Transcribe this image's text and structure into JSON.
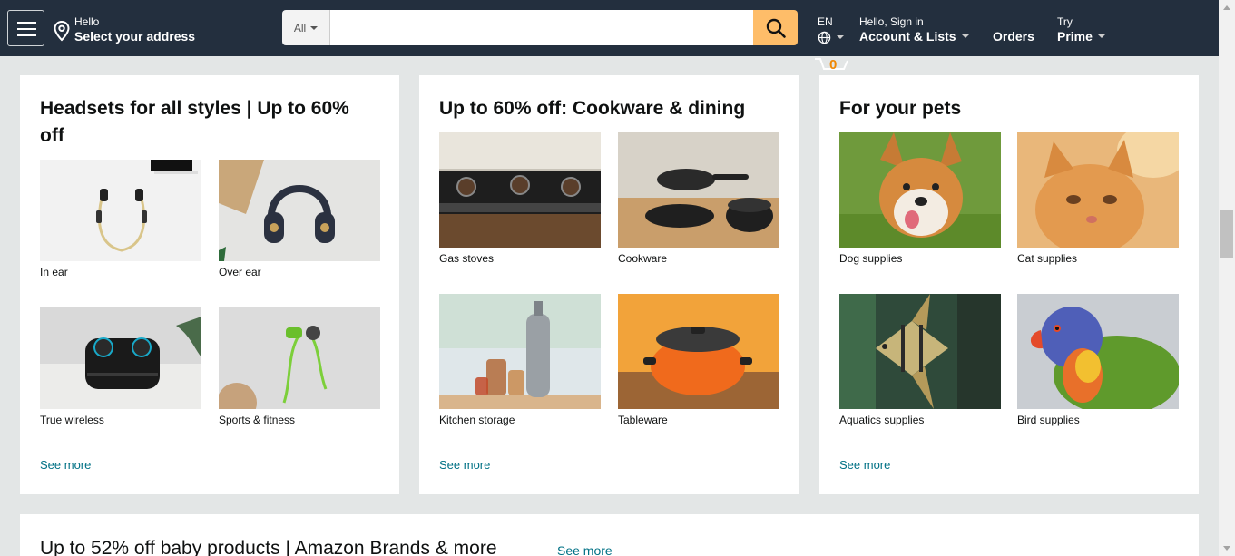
{
  "header": {
    "address_line1": "Hello",
    "address_line2": "Select your address",
    "search_category": "All",
    "search_placeholder": "",
    "lang": "EN",
    "account_line1": "Hello, Sign in",
    "account_line2": "Account & Lists",
    "orders": "Orders",
    "prime_line1": "Try",
    "prime_line2": "Prime",
    "cart_count": "0"
  },
  "colors": {
    "header_bg": "#232f3e",
    "search_button": "#febd69",
    "link": "#007185",
    "cart_count": "#f08804"
  },
  "cards": [
    {
      "title": "Headsets for all styles | Up to 60% off",
      "see_more": "See more",
      "items": [
        {
          "label": "In ear"
        },
        {
          "label": "Over ear"
        },
        {
          "label": "True wireless"
        },
        {
          "label": "Sports & fitness"
        }
      ]
    },
    {
      "title": "Up to 60% off: Cookware & dining",
      "see_more": "See more",
      "items": [
        {
          "label": "Gas stoves"
        },
        {
          "label": "Cookware"
        },
        {
          "label": "Kitchen storage"
        },
        {
          "label": "Tableware"
        }
      ]
    },
    {
      "title": "For your pets",
      "see_more": "See more",
      "items": [
        {
          "label": "Dog supplies"
        },
        {
          "label": "Cat supplies"
        },
        {
          "label": "Aquatics supplies"
        },
        {
          "label": "Bird supplies"
        }
      ]
    }
  ],
  "bottom_card": {
    "title": "Up to 52% off baby products | Amazon Brands & more",
    "see_more": "See more"
  }
}
